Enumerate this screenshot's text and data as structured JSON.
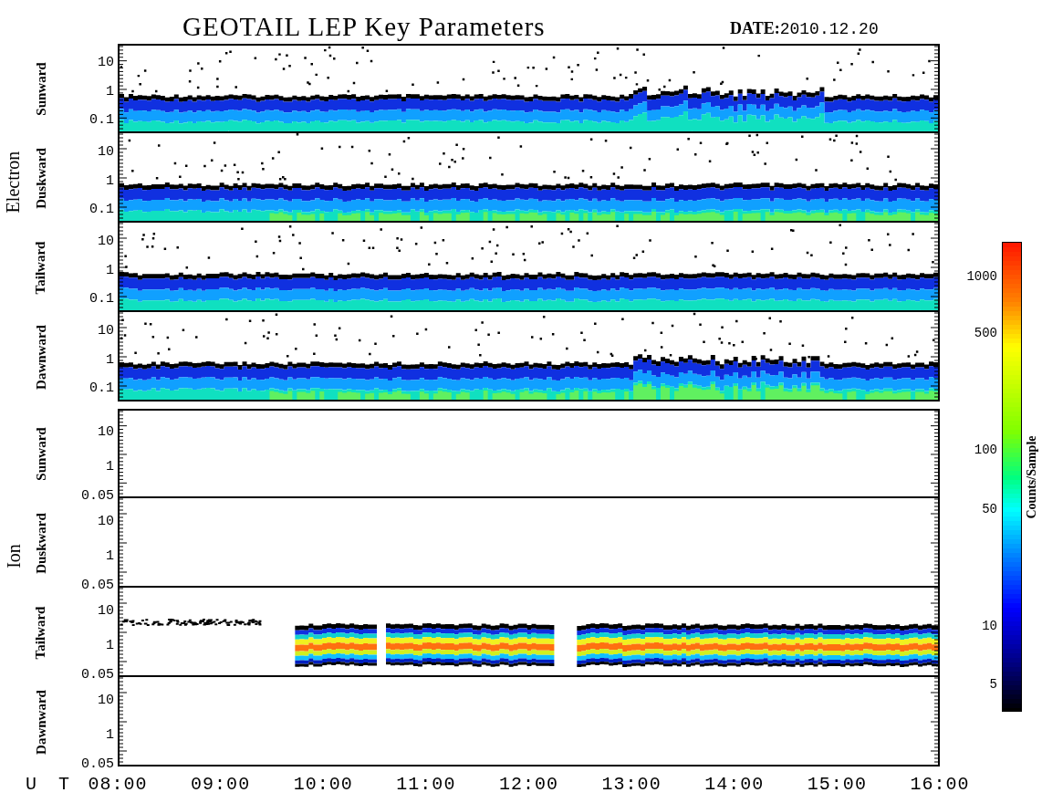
{
  "title": "GEOTAIL LEP Key Parameters",
  "date_label": "DATE:",
  "date": "2010.12.20",
  "groups": [
    {
      "label": "Electron",
      "panels": [
        {
          "label": "Sunward",
          "yticks": [
            "10",
            "1",
            "0.1"
          ]
        },
        {
          "label": "Duskward",
          "yticks": [
            "10",
            "1",
            "0.1"
          ]
        },
        {
          "label": "Tailward",
          "yticks": [
            "10",
            "1",
            "0.1"
          ]
        },
        {
          "label": "Dawnward",
          "yticks": [
            "10",
            "1",
            "0.1"
          ]
        }
      ]
    },
    {
      "label": "Ion",
      "panels": [
        {
          "label": "Sunward",
          "yticks": [
            "10",
            "1",
            "0.05"
          ]
        },
        {
          "label": "Duskward",
          "yticks": [
            "10",
            "1",
            "0.05"
          ]
        },
        {
          "label": "Tailward",
          "yticks": [
            "10",
            "1",
            "0.05"
          ]
        },
        {
          "label": "Dawnward",
          "yticks": [
            "10",
            "1",
            "0.05"
          ]
        }
      ]
    }
  ],
  "colorbar": {
    "title": "Counts/Sample",
    "ticks": [
      "1000",
      "500",
      "100",
      "50",
      "10",
      "5"
    ]
  },
  "time_axis": {
    "label": "U T",
    "ticks": [
      "08:00",
      "09:00",
      "10:00",
      "11:00",
      "12:00",
      "13:00",
      "14:00",
      "15:00",
      "16:00"
    ]
  }
}
